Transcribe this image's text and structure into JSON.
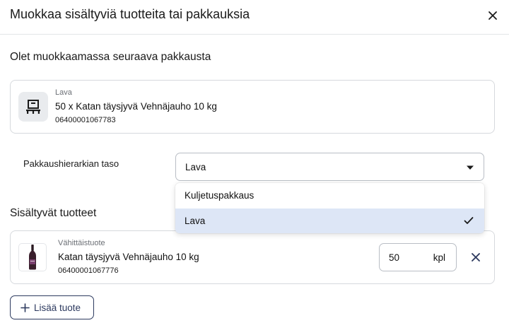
{
  "dialog": {
    "title": "Muokkaa sisältyviä tuotteita tai pakkauksia",
    "close_icon": "close-icon"
  },
  "editing": {
    "heading": "Olet muokkaamassa seuraava pakkausta",
    "package": {
      "type": "Lava",
      "name": "50 x Katan täysjyvä Vehnäjauho 10 kg",
      "ean": "06400001067783",
      "icon": "pallet-icon"
    }
  },
  "hierarchy": {
    "label": "Pakkaushierarkian taso",
    "selected": "Lava",
    "options": [
      {
        "label": "Kuljetuspakkaus",
        "selected": false
      },
      {
        "label": "Lava",
        "selected": true
      }
    ]
  },
  "contents": {
    "heading": "Sisältyvät tuotteet",
    "items": [
      {
        "type": "Vähittäistuote",
        "name": "Katan täysjyvä Vehnäjauho 10 kg",
        "ean": "06400001067776",
        "quantity": "50",
        "unit": "kpl",
        "icon": "wine-bottle-icon"
      }
    ]
  },
  "actions": {
    "add_product_label": "Lisää tuote",
    "add_icon": "plus-icon"
  },
  "colors": {
    "primary": "#2d3a5f",
    "selected_option_bg": "#dde6f6",
    "border": "#d6d9dd"
  }
}
